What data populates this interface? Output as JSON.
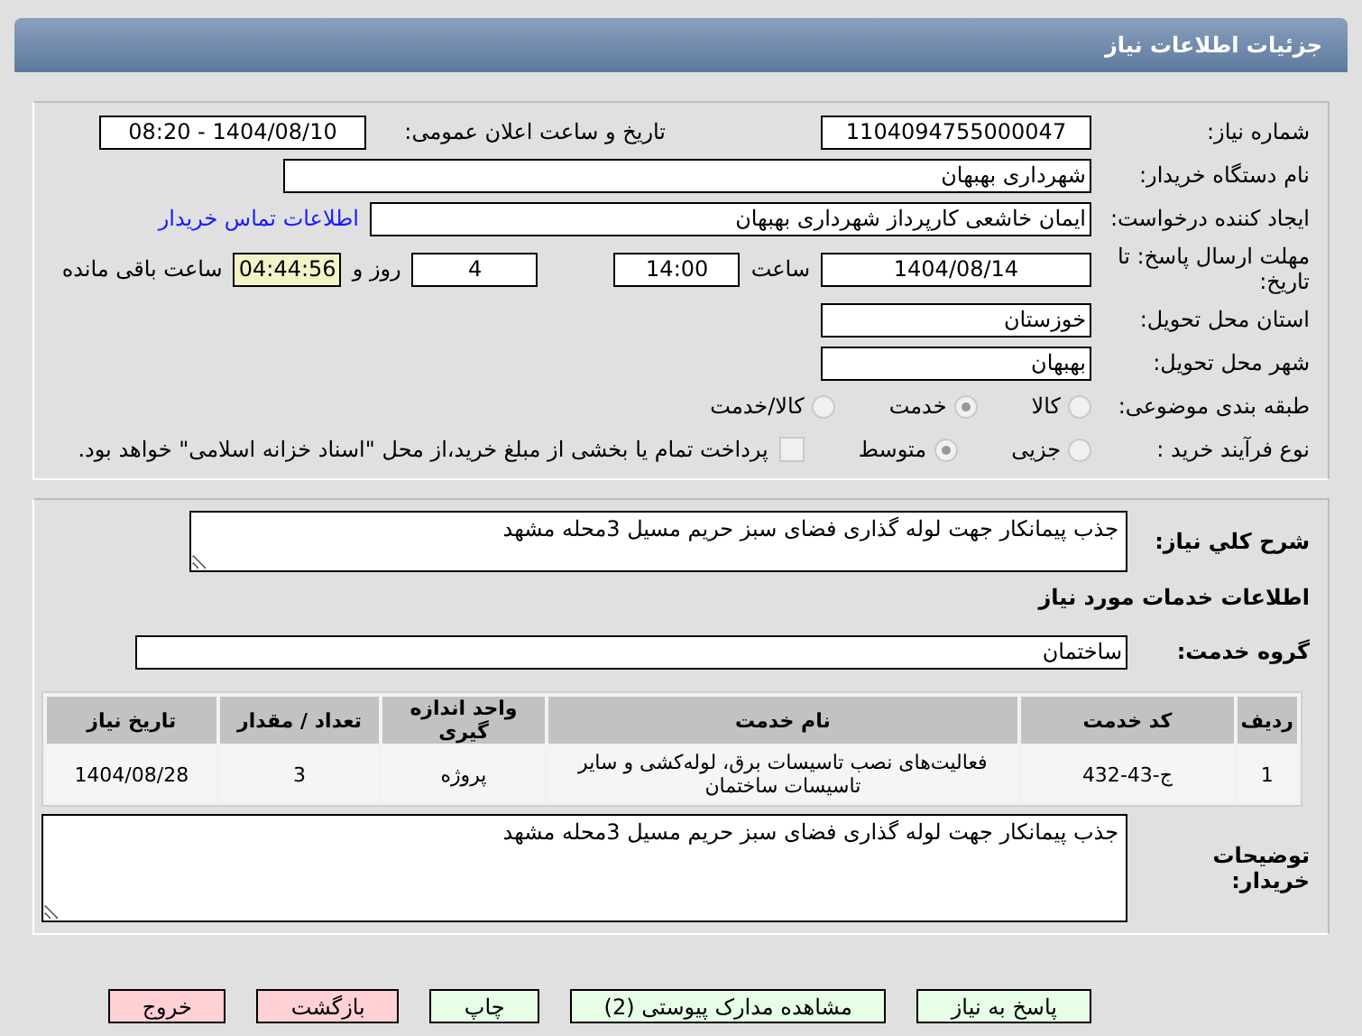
{
  "header": {
    "title": "جزئیات اطلاعات نیاز"
  },
  "need": {
    "number": {
      "label": "شماره نیاز:",
      "value": "1104094755000047"
    },
    "announce": {
      "label": "تاریخ و ساعت اعلان عمومی:",
      "value": "1404/08/10 - 08:20"
    },
    "buyer": {
      "label": "نام دستگاه خریدار:",
      "value": "شهرداری بهبهان"
    },
    "creator": {
      "label": "ایجاد کننده درخواست:",
      "value": "ایمان خاشعی کارپرداز شهرداری بهبهان"
    },
    "contact_link": "اطلاعات تماس خریدار",
    "deadline": {
      "label": "مهلت ارسال پاسخ: تا تاریخ:",
      "date": "1404/08/14",
      "time_label": "ساعت",
      "time": "14:00",
      "days": "4",
      "days_label": "روز و",
      "remaining": "04:44:56",
      "remaining_label": "ساعت باقی مانده"
    },
    "province": {
      "label": "استان محل تحویل:",
      "value": "خوزستان"
    },
    "city": {
      "label": "شهر محل تحویل:",
      "value": "بهبهان"
    },
    "category": {
      "label": "طبقه بندی موضوعی:",
      "options": [
        {
          "label": "کالا",
          "selected": false
        },
        {
          "label": "خدمت",
          "selected": true
        },
        {
          "label": "کالا/خدمت",
          "selected": false
        }
      ]
    },
    "process": {
      "label": "نوع فرآیند خرید :",
      "options": [
        {
          "label": "جزیی",
          "selected": false
        },
        {
          "label": "متوسط",
          "selected": true
        }
      ],
      "payment": {
        "checked": false,
        "label": "پرداخت تمام یا بخشی از مبلغ خرید،از محل \"اسناد خزانه اسلامی\" خواهد بود."
      }
    }
  },
  "description": {
    "label": "شرح کلي نياز:",
    "value": "جذب پیمانکار جهت لوله گذاری فضای سبز حریم مسیل 3محله مشهد"
  },
  "services_title": "اطلاعات خدمات مورد نیاز",
  "service_group": {
    "label": "گروه خدمت:",
    "value": "ساختمان"
  },
  "table": {
    "columns": [
      "ردیف",
      "کد خدمت",
      "نام خدمت",
      "واحد اندازه گیری",
      "تعداد / مقدار",
      "تاریخ نیاز"
    ],
    "rows": [
      [
        "1",
        "ج-43-432",
        "فعالیت‌های نصب تاسیسات برق، لوله‌کشی و سایر تاسیسات ساختمان",
        "پروژه",
        "3",
        "1404/08/28"
      ]
    ]
  },
  "buyer_notes": {
    "label": "توضیحات خریدار:",
    "value": "جذب پیمانکار جهت لوله گذاری فضای سبز حریم مسیل 3محله مشهد"
  },
  "buttons": [
    {
      "label": "پاسخ به نیاز",
      "kind": "green"
    },
    {
      "label": "مشاهده مدارک پیوستی (2)",
      "kind": "green"
    },
    {
      "label": "چاپ",
      "kind": "green"
    },
    {
      "label": "بازگشت",
      "kind": "red"
    },
    {
      "label": "خروج",
      "kind": "red"
    }
  ]
}
